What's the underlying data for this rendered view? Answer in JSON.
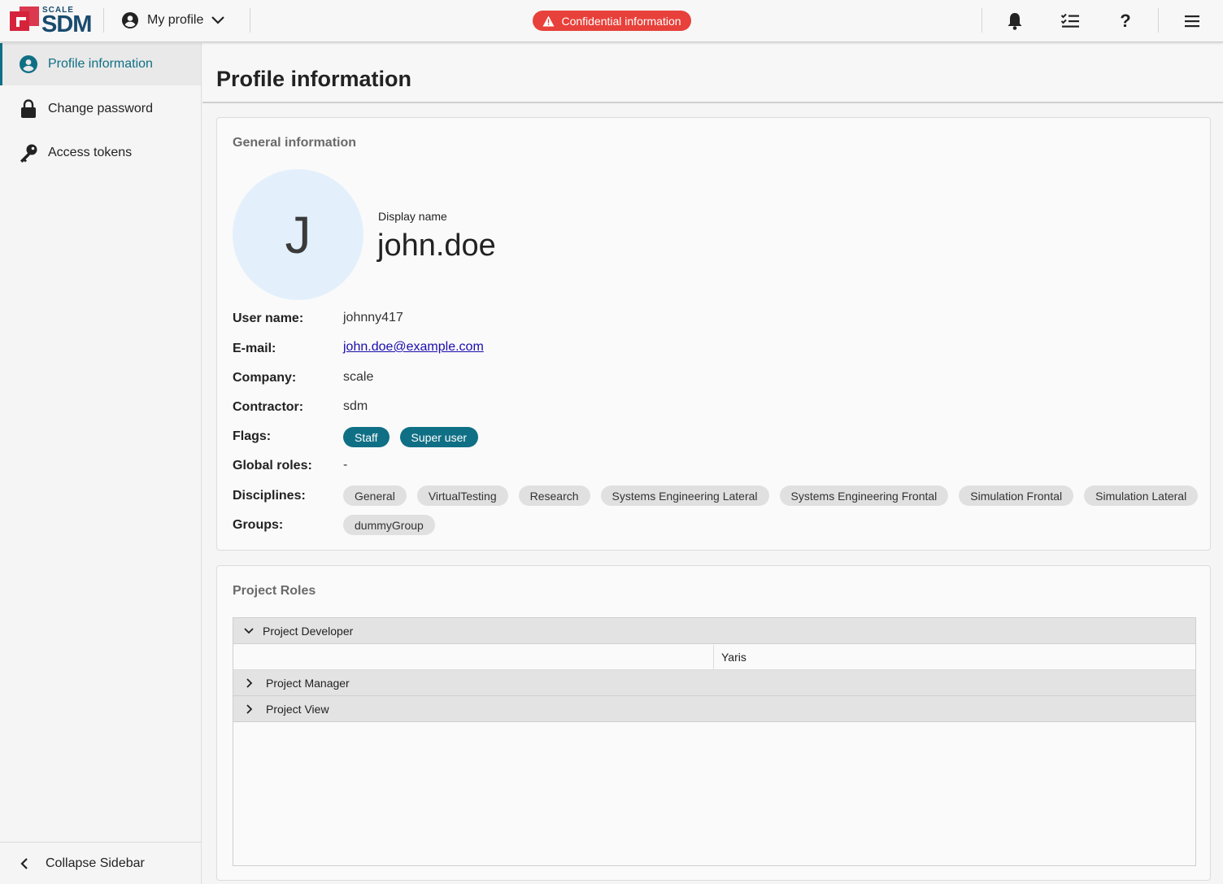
{
  "header": {
    "logo_small": "SCALE",
    "logo_big": "SDM",
    "profile_menu_label": "My profile",
    "confidential_label": "Confidential information",
    "colors": {
      "brand": "#1a4b6e",
      "logo_red": "#d6233c",
      "confidential": "#e8403a",
      "accent": "#0f6f85"
    },
    "icons": [
      "bell-icon",
      "tasks-icon",
      "help-icon",
      "menu-icon"
    ]
  },
  "sidebar": {
    "items": [
      {
        "label": "Profile information",
        "icon": "account-circle-icon",
        "active": true
      },
      {
        "label": "Change password",
        "icon": "lock-icon",
        "active": false
      },
      {
        "label": "Access tokens",
        "icon": "key-icon",
        "active": false
      }
    ],
    "collapse_label": "Collapse Sidebar"
  },
  "main": {
    "page_title": "Profile information",
    "general": {
      "title": "General information",
      "avatar_letter": "J",
      "display_name_label": "Display name",
      "display_name": "john.doe",
      "fields": {
        "username_label": "User name:",
        "username": "johnny417",
        "email_label": "E-mail:",
        "email": "john.doe@example.com",
        "company_label": "Company:",
        "company": "scale",
        "contractor_label": "Contractor:",
        "contractor": "sdm",
        "flags_label": "Flags:",
        "flags": [
          "Staff",
          "Super user"
        ],
        "global_roles_label": "Global roles:",
        "global_roles": "-",
        "disciplines_label": "Disciplines:",
        "disciplines": [
          "General",
          "VirtualTesting",
          "Research",
          "Systems Engineering Lateral",
          "Systems Engineering Frontal",
          "Simulation Frontal",
          "Simulation Lateral"
        ],
        "groups_label": "Groups:",
        "groups": [
          "dummyGroup"
        ]
      }
    },
    "project_roles": {
      "title": "Project Roles",
      "groups": [
        {
          "label": "Project Developer",
          "expanded": true,
          "rows": [
            "Yaris"
          ]
        },
        {
          "label": "Project Manager",
          "expanded": false
        },
        {
          "label": "Project View",
          "expanded": false
        }
      ]
    }
  }
}
